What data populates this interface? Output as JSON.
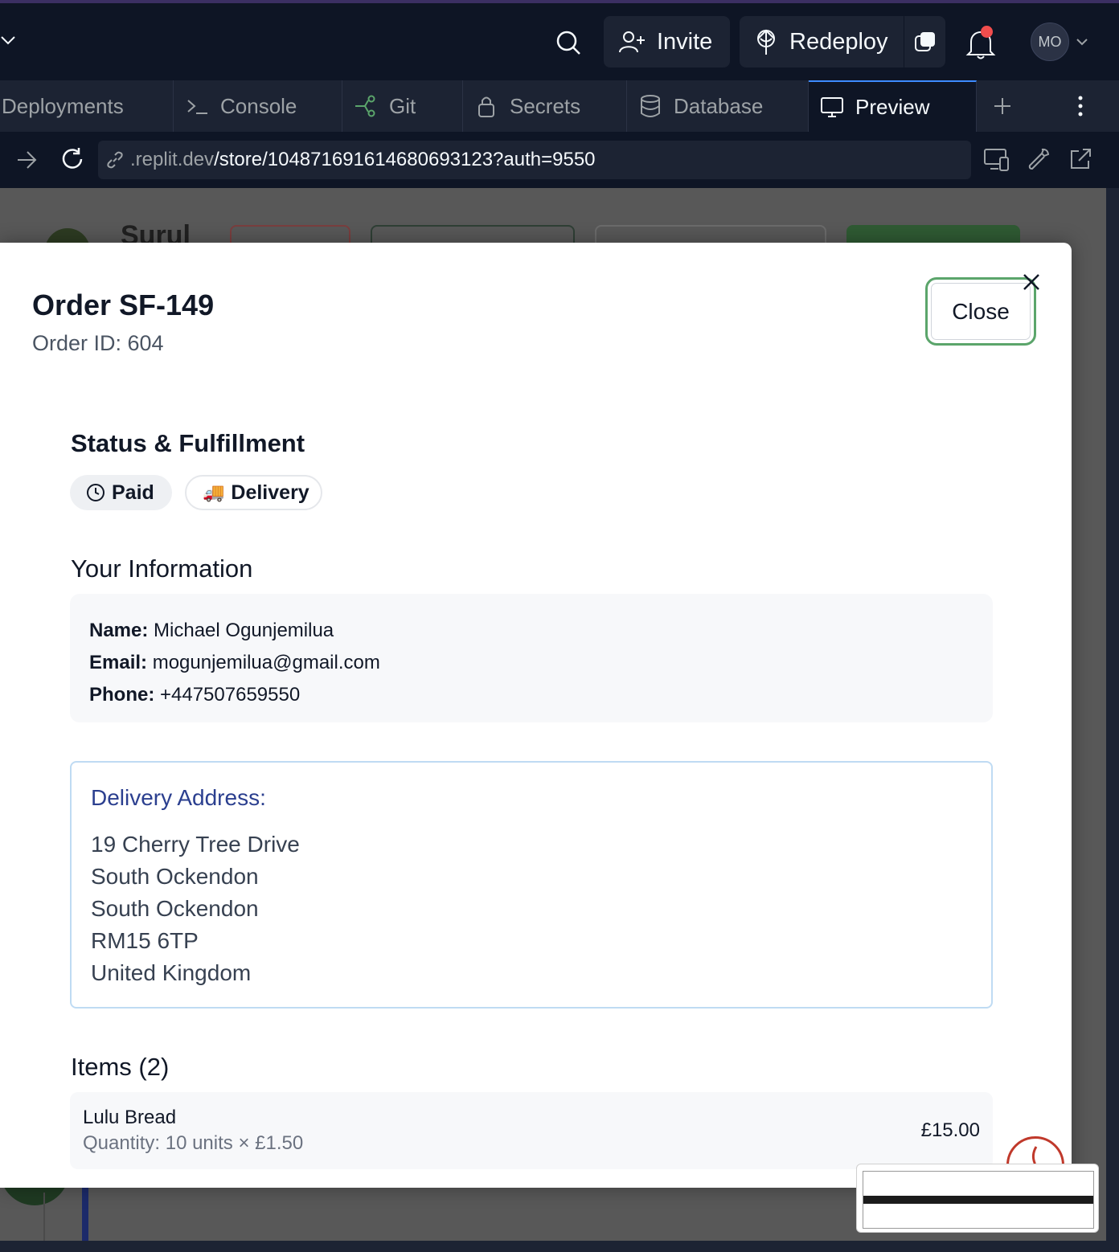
{
  "topbar": {
    "invite_label": "Invite",
    "redeploy_label": "Redeploy",
    "avatar_initials": "MO"
  },
  "tabs": [
    {
      "label": "Deployments",
      "icon": "rocket-icon"
    },
    {
      "label": "Console",
      "icon": "terminal-icon"
    },
    {
      "label": "Git",
      "icon": "git-icon"
    },
    {
      "label": "Secrets",
      "icon": "lock-icon"
    },
    {
      "label": "Database",
      "icon": "database-icon"
    },
    {
      "label": "Preview",
      "icon": "monitor-icon",
      "active": true
    }
  ],
  "urlbar": {
    "domain": ".replit.dev",
    "path": "/store/10487169161468069312​3?auth=9550"
  },
  "background": {
    "store_title": "Surul"
  },
  "modal": {
    "title": "Order SF-149",
    "subtitle": "Order ID: 604",
    "close_label": "Close",
    "status_heading": "Status & Fulfillment",
    "status_pill": "Paid",
    "fulfillment_pill": "Delivery",
    "fulfillment_emoji": "🚚",
    "info_heading": "Your Information",
    "info": {
      "name_label": "Name:",
      "name": "Michael Ogunjemilua",
      "email_label": "Email:",
      "email": "mogunjemilua@gmail.com",
      "phone_label": "Phone:",
      "phone": "+447507659550"
    },
    "address": {
      "heading": "Delivery Address:",
      "line1": "19 Cherry Tree Drive",
      "line2": "South Ockendon",
      "line3": "South Ockendon",
      "line4": "RM15 6TP",
      "line5": "United Kingdom"
    },
    "items_heading": "Items (2)",
    "items": [
      {
        "name": "Lulu Bread",
        "qty": "Quantity: 10 units × £1.50",
        "price": "£15.00"
      }
    ]
  },
  "colors": {
    "accent_green": "#5ba56b",
    "address_heading": "#2b3f8f",
    "ide_bg": "#0e1525",
    "ide_panel": "#1c2333",
    "active_tab_border": "#3d8bff",
    "notification_dot": "#f14d4d"
  }
}
